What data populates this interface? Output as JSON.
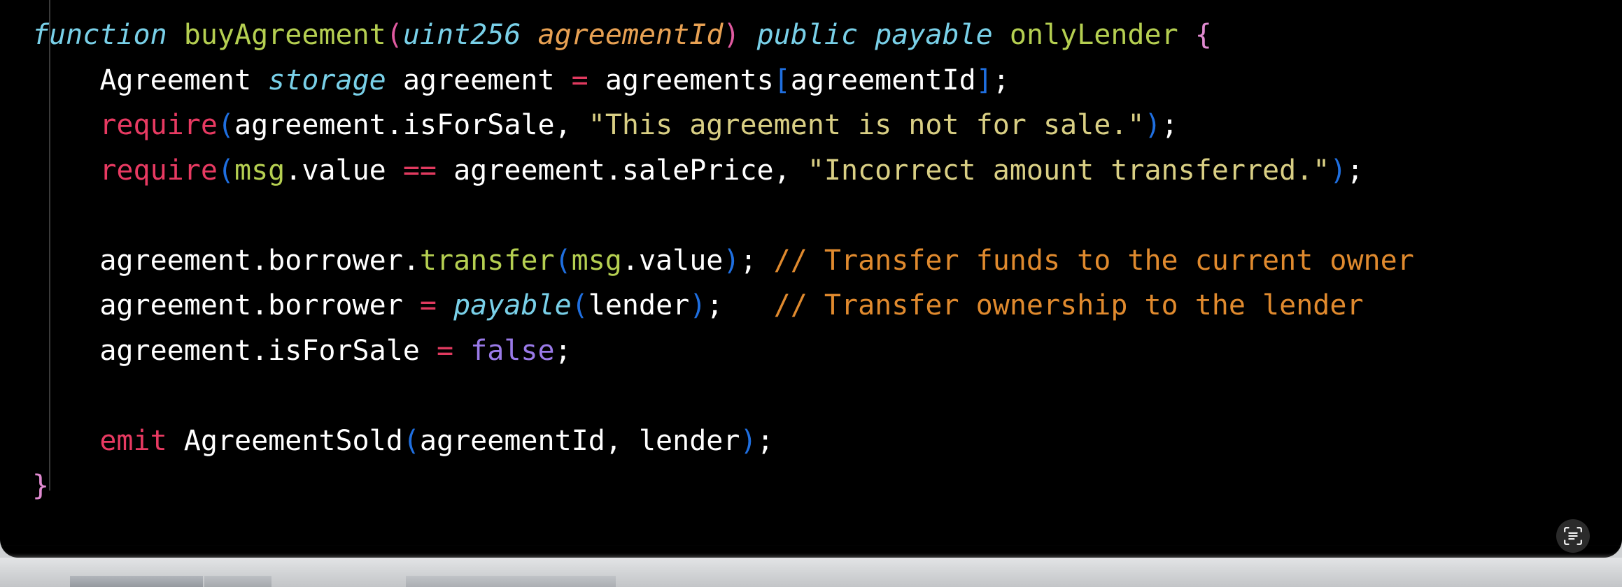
{
  "window": {
    "panel_background": "#000000",
    "frame_background": "#cfd1d3"
  },
  "editor": {
    "language": "Solidity",
    "theme": "dark",
    "indent_guide_color": "#3a3a3a",
    "colors": {
      "keyword": "#79d0e8",
      "function": "#b5cf51",
      "parameter": "#e8a153",
      "operator": "#e03a5f",
      "require_keyword": "#e83a62",
      "bracket": "#1f6fe0",
      "signature_paren": "#e05aa0",
      "brace": "#e08ad0",
      "string": "#d9cf84",
      "comment": "#e08a2e",
      "boolean": "#9a7ae8",
      "plain_text": "#ffffff"
    },
    "code_lines": [
      {
        "index": 1,
        "tokens": [
          {
            "text": "function",
            "kind": "keyword"
          },
          {
            "text": " ",
            "kind": "plain"
          },
          {
            "text": "buyAgreement",
            "kind": "function"
          },
          {
            "text": "(",
            "kind": "signature_paren"
          },
          {
            "text": "uint256",
            "kind": "type"
          },
          {
            "text": " ",
            "kind": "plain"
          },
          {
            "text": "agreementId",
            "kind": "parameter"
          },
          {
            "text": ")",
            "kind": "signature_paren"
          },
          {
            "text": " ",
            "kind": "plain"
          },
          {
            "text": "public",
            "kind": "keyword"
          },
          {
            "text": " ",
            "kind": "plain"
          },
          {
            "text": "payable",
            "kind": "keyword"
          },
          {
            "text": " ",
            "kind": "plain"
          },
          {
            "text": "onlyLender",
            "kind": "function"
          },
          {
            "text": " ",
            "kind": "plain"
          },
          {
            "text": "{",
            "kind": "brace"
          }
        ]
      },
      {
        "index": 2,
        "tokens": [
          {
            "text": "    ",
            "kind": "plain"
          },
          {
            "text": "Agreement",
            "kind": "plain"
          },
          {
            "text": " ",
            "kind": "plain"
          },
          {
            "text": "storage",
            "kind": "keyword"
          },
          {
            "text": " agreement ",
            "kind": "plain"
          },
          {
            "text": "=",
            "kind": "operator"
          },
          {
            "text": " agreements",
            "kind": "plain"
          },
          {
            "text": "[",
            "kind": "bracket"
          },
          {
            "text": "agreementId",
            "kind": "plain"
          },
          {
            "text": "]",
            "kind": "bracket"
          },
          {
            "text": ";",
            "kind": "plain"
          }
        ]
      },
      {
        "index": 3,
        "tokens": [
          {
            "text": "    ",
            "kind": "plain"
          },
          {
            "text": "require",
            "kind": "require_keyword"
          },
          {
            "text": "(",
            "kind": "bracket"
          },
          {
            "text": "agreement.isForSale, ",
            "kind": "plain"
          },
          {
            "text": "\"This agreement is not for sale.\"",
            "kind": "string"
          },
          {
            "text": ")",
            "kind": "bracket"
          },
          {
            "text": ";",
            "kind": "plain"
          }
        ]
      },
      {
        "index": 4,
        "tokens": [
          {
            "text": "    ",
            "kind": "plain"
          },
          {
            "text": "require",
            "kind": "require_keyword"
          },
          {
            "text": "(",
            "kind": "bracket"
          },
          {
            "text": "msg",
            "kind": "function"
          },
          {
            "text": ".value ",
            "kind": "plain"
          },
          {
            "text": "==",
            "kind": "operator"
          },
          {
            "text": " agreement.salePrice, ",
            "kind": "plain"
          },
          {
            "text": "\"Incorrect amount transferred.\"",
            "kind": "string"
          },
          {
            "text": ")",
            "kind": "bracket"
          },
          {
            "text": ";",
            "kind": "plain"
          }
        ]
      },
      {
        "index": 5,
        "tokens": []
      },
      {
        "index": 6,
        "tokens": [
          {
            "text": "    ",
            "kind": "plain"
          },
          {
            "text": "agreement.borrower.",
            "kind": "plain"
          },
          {
            "text": "transfer",
            "kind": "function"
          },
          {
            "text": "(",
            "kind": "bracket"
          },
          {
            "text": "msg",
            "kind": "function"
          },
          {
            "text": ".value",
            "kind": "plain"
          },
          {
            "text": ")",
            "kind": "bracket"
          },
          {
            "text": "; ",
            "kind": "plain"
          },
          {
            "text": "// Transfer funds to the current owner",
            "kind": "comment"
          }
        ]
      },
      {
        "index": 7,
        "tokens": [
          {
            "text": "    ",
            "kind": "plain"
          },
          {
            "text": "agreement.borrower ",
            "kind": "plain"
          },
          {
            "text": "=",
            "kind": "operator"
          },
          {
            "text": " ",
            "kind": "plain"
          },
          {
            "text": "payable",
            "kind": "keyword"
          },
          {
            "text": "(",
            "kind": "bracket"
          },
          {
            "text": "lender",
            "kind": "plain"
          },
          {
            "text": ")",
            "kind": "bracket"
          },
          {
            "text": ";   ",
            "kind": "plain"
          },
          {
            "text": "// Transfer ownership to the lender",
            "kind": "comment"
          }
        ]
      },
      {
        "index": 8,
        "tokens": [
          {
            "text": "    ",
            "kind": "plain"
          },
          {
            "text": "agreement.isForSale ",
            "kind": "plain"
          },
          {
            "text": "=",
            "kind": "operator"
          },
          {
            "text": " ",
            "kind": "plain"
          },
          {
            "text": "false",
            "kind": "boolean"
          },
          {
            "text": ";",
            "kind": "plain"
          }
        ]
      },
      {
        "index": 9,
        "tokens": []
      },
      {
        "index": 10,
        "tokens": [
          {
            "text": "    ",
            "kind": "plain"
          },
          {
            "text": "emit",
            "kind": "require_keyword"
          },
          {
            "text": " AgreementSold",
            "kind": "plain"
          },
          {
            "text": "(",
            "kind": "bracket"
          },
          {
            "text": "agreementId, lender",
            "kind": "plain"
          },
          {
            "text": ")",
            "kind": "bracket"
          },
          {
            "text": ";",
            "kind": "plain"
          }
        ]
      },
      {
        "index": 11,
        "tokens": [
          {
            "text": "}",
            "kind": "brace"
          }
        ]
      }
    ],
    "plain_text": "function buyAgreement(uint256 agreementId) public payable onlyLender {\n    Agreement storage agreement = agreements[agreementId];\n    require(agreement.isForSale, \"This agreement is not for sale.\");\n    require(msg.value == agreement.salePrice, \"Incorrect amount transferred.\");\n\n    agreement.borrower.transfer(msg.value); // Transfer funds to the current owner\n    agreement.borrower = payable(lender);   // Transfer ownership to the lender\n    agreement.isForSale = false;\n\n    emit AgreementSold(agreementId, lender);\n}"
  },
  "overlay": {
    "scan_button": {
      "icon": "live-text-scan-icon",
      "background": "#2b2b2b",
      "foreground": "#ffffff"
    }
  }
}
